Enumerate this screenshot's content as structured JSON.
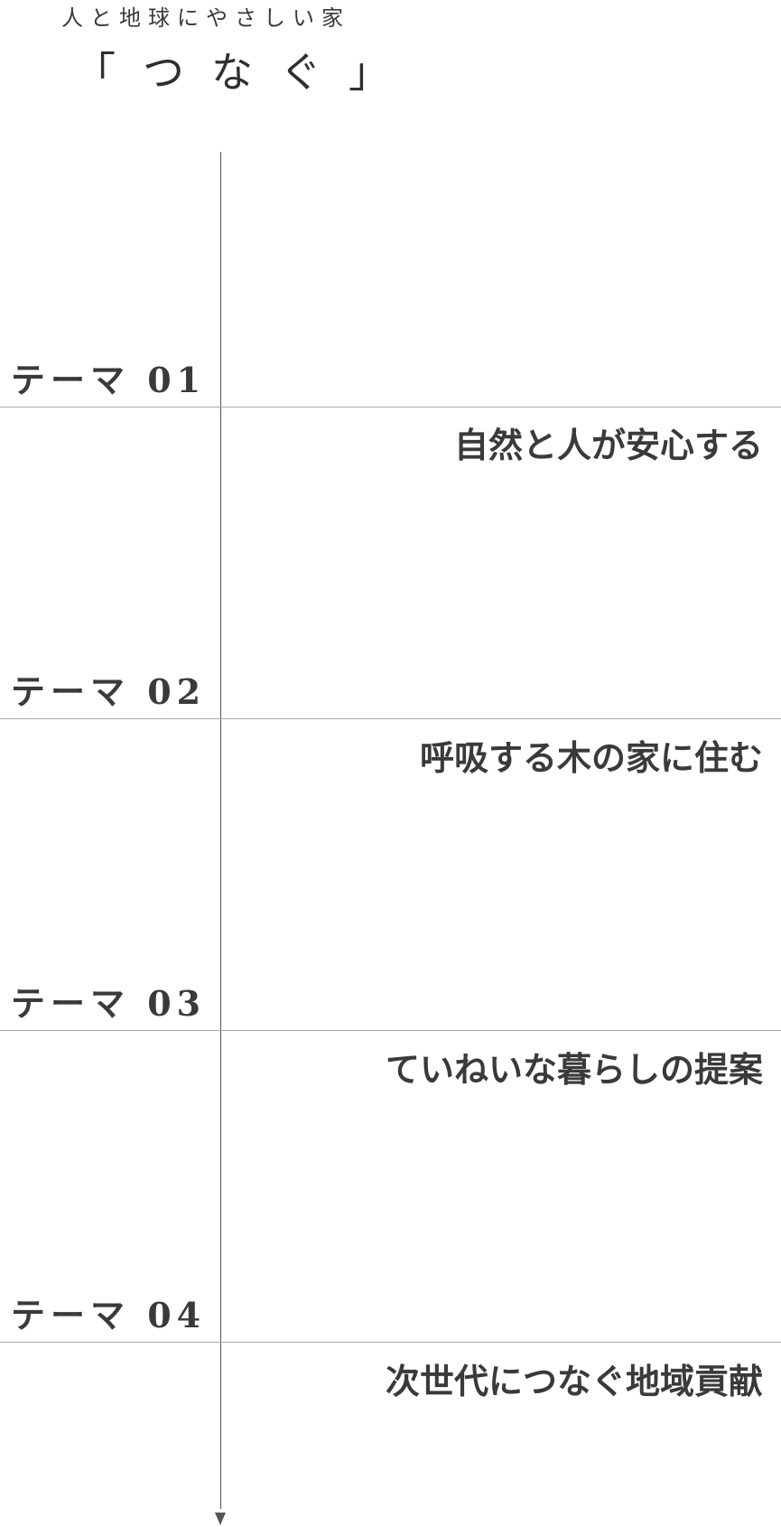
{
  "header": {
    "subtitle": "人と地球にやさしい家",
    "brand": "「つなぐ」"
  },
  "themes": [
    {
      "label": "テーマ 01",
      "title": "自然と人が安心する"
    },
    {
      "label": "テーマ 02",
      "title": "呼吸する木の家に住む"
    },
    {
      "label": "テーマ 03",
      "title": "ていねいな暮らしの提案"
    },
    {
      "label": "テーマ 04",
      "title": "次世代につなぐ地域貢献"
    }
  ],
  "colors": {
    "text": "#3a3a3a",
    "rule": "#a8a8a8",
    "axis": "#555555"
  }
}
